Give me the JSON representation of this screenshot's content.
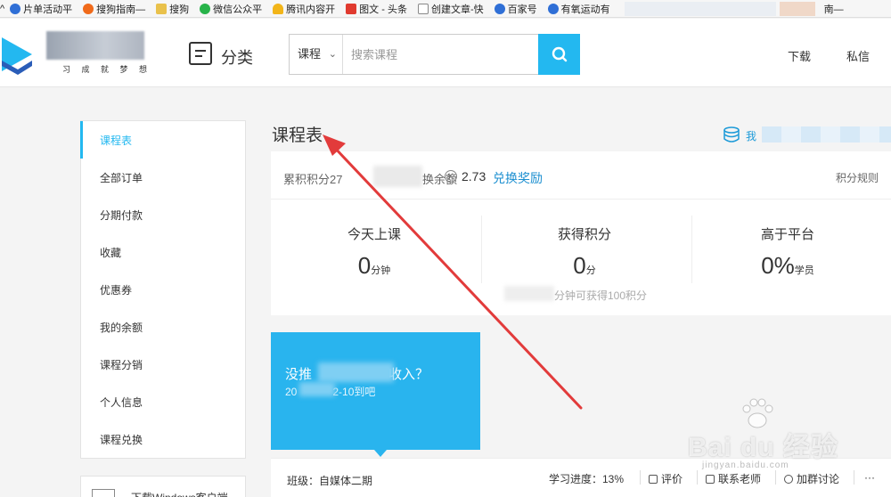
{
  "bookmarks": [
    {
      "label": "片单活动平",
      "icon": "paw-icon",
      "color": "#2f6fd6"
    },
    {
      "label": "搜狗指南—",
      "icon": "sogou-icon",
      "color": "#f06a1a"
    },
    {
      "label": "搜狗",
      "icon": "folder-icon",
      "color": "#e9c14b"
    },
    {
      "label": "微信公众平",
      "icon": "wechat-icon",
      "color": "#28b34a"
    },
    {
      "label": "腾讯内容开",
      "icon": "bell-icon",
      "color": "#f2b519"
    },
    {
      "label": "图文 - 头条",
      "icon": "toutiao-icon",
      "color": "#e03a2f"
    },
    {
      "label": "创建文章-快",
      "icon": "doc-icon",
      "color": "#888888"
    },
    {
      "label": "百家号",
      "icon": "paw-icon",
      "color": "#2f6fd6"
    },
    {
      "label": "有氧运动有",
      "icon": "paw-icon",
      "color": "#2f6fd6"
    },
    {
      "label": "南—",
      "icon": "blank",
      "color": "#cccccc"
    }
  ],
  "header": {
    "logo_sub": "习 成 就 梦 想",
    "category_label": "分类",
    "search": {
      "select_value": "课程",
      "placeholder": "搜索课程"
    },
    "download": "下载",
    "messages": "私信"
  },
  "sidebar": {
    "items": [
      {
        "label": "课程表",
        "active": true
      },
      {
        "label": "全部订单"
      },
      {
        "label": "分期付款"
      },
      {
        "label": "收藏"
      },
      {
        "label": "优惠券"
      },
      {
        "label": "我的余额"
      },
      {
        "label": "课程分销"
      },
      {
        "label": "个人信息"
      },
      {
        "label": "课程兑换"
      }
    ],
    "download_client": "下载Windows客户端"
  },
  "main": {
    "title": "课程表",
    "wallet_text": "我",
    "points_label": "累积积分27",
    "balance_label": "换余额",
    "coin_symbol": "K",
    "balance_value": "2.73",
    "redeem_label": "兑换奖励",
    "rules_label": "积分规则",
    "stats": [
      {
        "label": "今天上课",
        "value": "0",
        "unit": "分钟"
      },
      {
        "label": "获得积分",
        "value": "0",
        "unit": "分"
      },
      {
        "label": "高于平台",
        "value": "0%",
        "unit": "学员"
      }
    ],
    "stat_note": "分钟可获得100积分",
    "promo": {
      "title": "没推",
      "title_end": "收入？",
      "date": "20",
      "date_end": "2-10到吧"
    },
    "class_label": "班级：自媒体二期",
    "progress_label": "学习进度：13%",
    "actions": {
      "review": "评价",
      "contact": "联系老师",
      "join_group": "加群讨论",
      "more": "···"
    }
  },
  "watermark": {
    "main": "Bai du 经验",
    "sub": "jingyan.baidu.com"
  },
  "colors": {
    "accent": "#23b8f0",
    "promo_bg": "#29b4ee",
    "annotation_arrow": "#e23b3b"
  }
}
